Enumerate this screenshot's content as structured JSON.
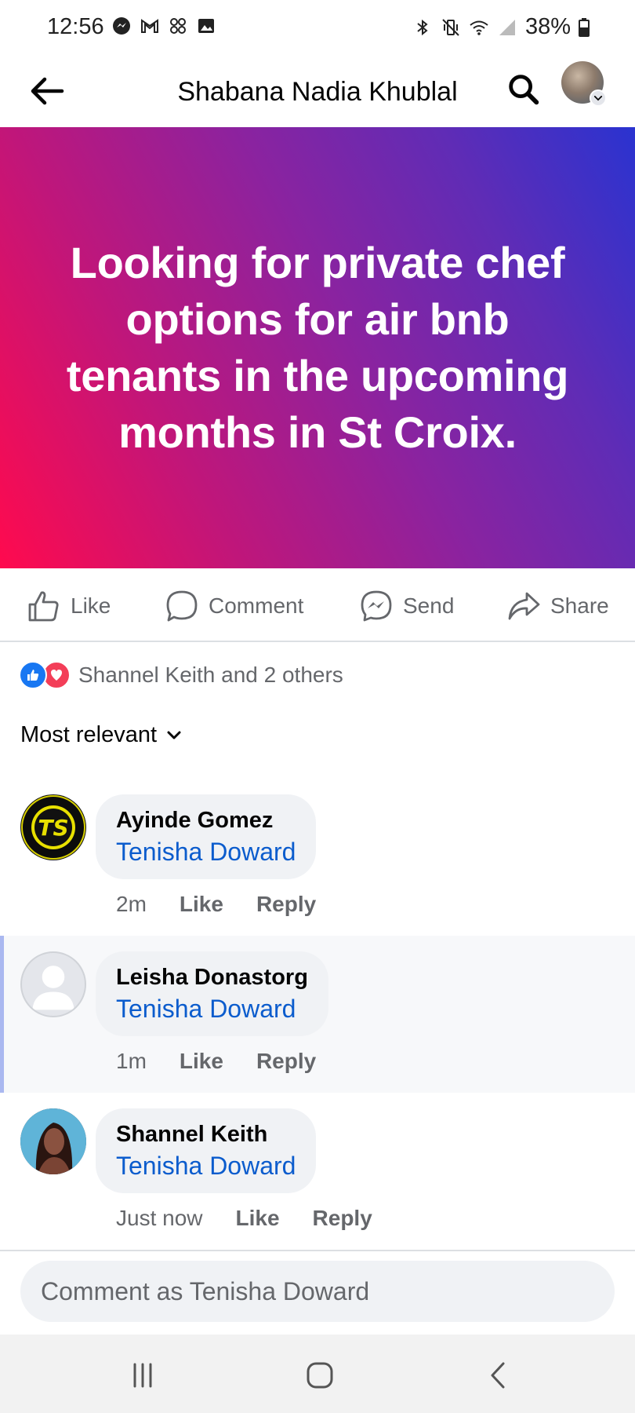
{
  "status_bar": {
    "time": "12:56",
    "battery": "38%",
    "icons_left": [
      "messenger-icon",
      "gmail-icon",
      "pinwheel-icon",
      "gallery-icon"
    ],
    "icons_right": [
      "bluetooth-icon",
      "vibrate-icon",
      "wifi-icon",
      "signal-icon",
      "battery-icon"
    ]
  },
  "header": {
    "title": "Shabana Nadia Khublal"
  },
  "post": {
    "text": "Looking for private chef options for air bnb tenants in the upcoming months in St Croix.",
    "gradient_colors": [
      "#ff0a4e",
      "#8a23a0",
      "#2a33d0"
    ]
  },
  "actions": {
    "like": "Like",
    "comment": "Comment",
    "send": "Send",
    "share": "Share"
  },
  "reactions": {
    "summary": "Shannel Keith and 2 others"
  },
  "sort": {
    "label": "Most relevant"
  },
  "comments": [
    {
      "name": "Ayinde Gomez",
      "text": "Tenisha Doward",
      "time": "2m",
      "like": "Like",
      "reply": "Reply",
      "avatar_text": "TS"
    },
    {
      "name": "Leisha Donastorg",
      "text": "Tenisha Doward",
      "time": "1m",
      "like": "Like",
      "reply": "Reply"
    },
    {
      "name": "Shannel Keith",
      "text": "Tenisha Doward",
      "time": "Just now",
      "like": "Like",
      "reply": "Reply"
    }
  ],
  "comment_box": {
    "placeholder": "Comment as Tenisha Doward"
  },
  "colors": {
    "accent": "#1877f2",
    "link": "#0b5ccd",
    "love": "#f33e58",
    "muted": "#65676b"
  }
}
